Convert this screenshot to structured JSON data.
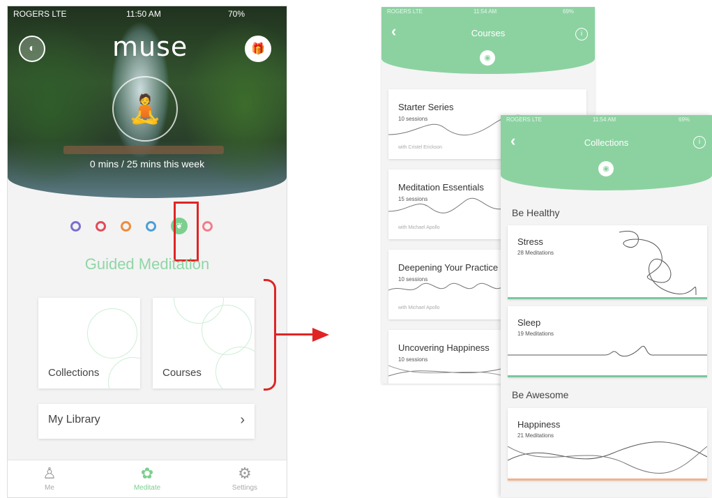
{
  "main": {
    "status": {
      "carrier": "ROGERS LTE",
      "time": "11:50 AM",
      "battery": "70%"
    },
    "brand": "muse",
    "stats_text": "0 mins / 25 mins this week",
    "section_title": "Guided Meditation",
    "mode_colors": [
      "#7b6fd1",
      "#e24b5a",
      "#ef8b3b",
      "#4a9fd8",
      "#7ccf8f",
      "#f07e8a"
    ],
    "cards": [
      {
        "label": "Collections"
      },
      {
        "label": "Courses"
      }
    ],
    "library_label": "My Library",
    "tabs": [
      {
        "label": "Me",
        "icon": "person-icon"
      },
      {
        "label": "Meditate",
        "icon": "lotus-icon"
      },
      {
        "label": "Settings",
        "icon": "gear-icon"
      }
    ],
    "accent": "#8fd6a6",
    "highlight_color": "#e02424"
  },
  "courses_screen": {
    "status": {
      "carrier": "ROGERS LTE",
      "time": "11:54 AM",
      "battery": "69%"
    },
    "title": "Courses",
    "cards": [
      {
        "title": "Starter Series",
        "sessions": "10 sessions",
        "author": "with Cristel Erickson"
      },
      {
        "title": "Meditation Essentials",
        "sessions": "15 sessions",
        "author": "with Michael Apollo"
      },
      {
        "title": "Deepening Your Practice",
        "sessions": "10 sessions",
        "author": "with Michael Apollo"
      },
      {
        "title": "Uncovering Happiness",
        "sessions": "10 sessions",
        "author": ""
      }
    ]
  },
  "collections_screen": {
    "status": {
      "carrier": "ROGERS LTE",
      "time": "11:54 AM",
      "battery": "69%"
    },
    "title": "Collections",
    "groups": [
      {
        "label": "Be Healthy",
        "items": [
          {
            "title": "Stress",
            "count": "28 Meditations",
            "bar_color": "#7ac6a0"
          },
          {
            "title": "Sleep",
            "count": "19 Meditations",
            "bar_color": "#7ac6a0"
          }
        ]
      },
      {
        "label": "Be Awesome",
        "items": [
          {
            "title": "Happiness",
            "count": "21 Meditations",
            "bar_color": "#f0b48a"
          }
        ]
      }
    ]
  }
}
